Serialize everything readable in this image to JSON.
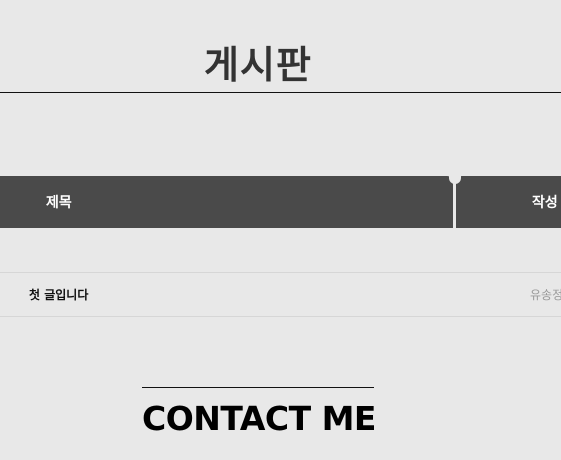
{
  "board": {
    "title": "게시판",
    "columns": {
      "title": "제목",
      "author": "작성"
    },
    "posts": [
      {
        "title": "첫 글입니다",
        "author": "유송정"
      }
    ]
  },
  "contact": {
    "heading": "CONTACT ME"
  },
  "colors": {
    "background": "#e8e8e8",
    "header_bg": "#4a4a4a",
    "header_text": "#ffffff",
    "author_text": "#9a9a9a"
  }
}
